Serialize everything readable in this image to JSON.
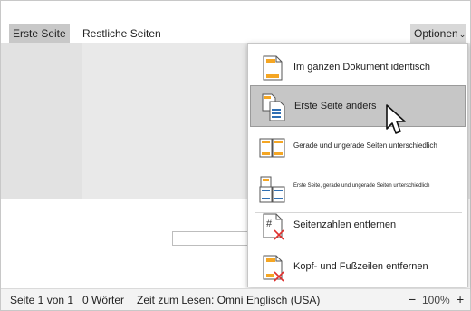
{
  "tabs": {
    "first_page": "Erste Seite",
    "rest_pages": "Restliche Seiten",
    "options": "Optionen"
  },
  "menu": {
    "items": [
      {
        "label": "Im ganzen Dokument identisch",
        "icon": "same-header-icon"
      },
      {
        "label": "Erste Seite anders",
        "icon": "different-first-page-icon",
        "selected": true
      },
      {
        "label": "Gerade und ungerade Seiten unterschiedlich",
        "icon": "odd-even-pages-icon"
      },
      {
        "label": "Erste Seite, gerade und ungerade Seiten unterschiedlich",
        "icon": "first-odd-even-icon"
      },
      {
        "label": "Seitenzahlen entfernen",
        "icon": "remove-page-numbers-icon"
      },
      {
        "label": "Kopf- und Fußzeilen entfernen",
        "icon": "remove-header-footer-icon"
      }
    ]
  },
  "statusbar": {
    "page": "Seite 1 von 1",
    "words": "0 Wörter",
    "reading_time": "Zeit zum Lesen: Omni",
    "language": "Englisch (USA)",
    "zoom_minus": "−",
    "zoom": "100%",
    "zoom_plus": "+"
  },
  "colors": {
    "menu_selected": "#c6c6c6",
    "icon_orange": "#f5a623",
    "icon_blue": "#2f6fb3",
    "remove_red": "#e0312f"
  }
}
